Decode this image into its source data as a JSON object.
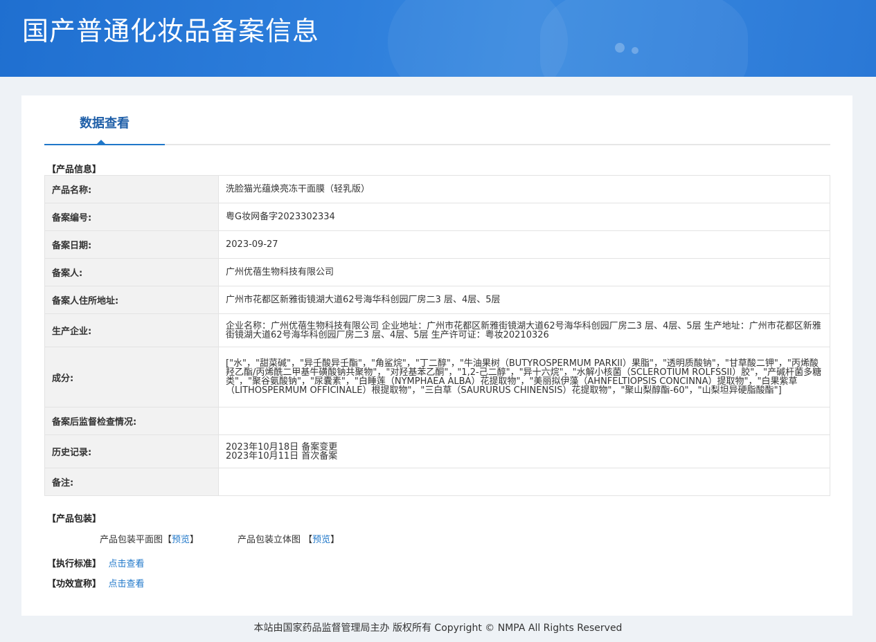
{
  "header": {
    "title": "国产普通化妆品备案信息"
  },
  "tabs": [
    {
      "label": "数据查看"
    }
  ],
  "product_info": {
    "section_label": "【产品信息】",
    "rows": [
      {
        "key": "产品名称:",
        "value": "洗脸猫光蕴焕亮冻干面膜（轻乳版）"
      },
      {
        "key": "备案编号:",
        "value": "粤G妆网备字2023302334"
      },
      {
        "key": "备案日期:",
        "value": "2023-09-27"
      },
      {
        "key": "备案人:",
        "value": "广州优蓓生物科技有限公司"
      },
      {
        "key": "备案人住所地址:",
        "value": "广州市花都区新雅街镜湖大道62号海华科创园厂房二3 层、4层、5层"
      },
      {
        "key": "生产企业:",
        "value": "企业名称：广州优蓓生物科技有限公司 企业地址：广州市花都区新雅街镜湖大道62号海华科创园厂房二3 层、4层、5层 生产地址：广州市花都区新雅街镜湖大道62号海华科创园厂房二3 层、4层、5层 生产许可证：粤妆20210326"
      },
      {
        "key": "成分:",
        "value": "[\"水\"，\"甜菜碱\"，\"异壬酸异壬酯\"，\"角鲨烷\"，\"丁二醇\"，\"牛油果树（BUTYROSPERMUM PARKII）果脂\"，\"透明质酸钠\"，\"甘草酸二钾\"，\"丙烯酸羟乙酯/丙烯酰二甲基牛磺酸钠共聚物\"，\"对羟基苯乙酮\"，\"1,2-己二醇\"，\"异十六烷\"，\"水解小核菌（SCLEROTIUM ROLFSSII）胶\"，\"产碱杆菌多糖类\"，\"聚谷氨酸钠\"，\"尿囊素\"，\"白睡莲（NYMPHAEA ALBA）花提取物\"，\"美丽拟伊藻（AHNFELTIOPSIS CONCINNA）提取物\"，\"白果紫草（LITHOSPERMUM OFFICINALE）根提取物\"，\"三白草（SAURURUS CHINENSIS）花提取物\"，\"聚山梨醇酯-60\"，\"山梨坦异硬脂酸酯\"]"
      },
      {
        "key": "备案后监督检查情况:",
        "value": ""
      },
      {
        "key": "历史记录:",
        "value": [
          "2023年10月18日 备案变更",
          "2023年10月11日 首次备案"
        ]
      },
      {
        "key": "备注:",
        "value": ""
      }
    ]
  },
  "packaging": {
    "section_label": "【产品包装】",
    "flat_label": "产品包装平面图【",
    "flat_link": "预览",
    "flat_close": "】",
    "solid_label": "产品包装立体图 【",
    "solid_link": "预览",
    "solid_close": "】"
  },
  "standard": {
    "label": "【执行标准】",
    "link": "点击查看"
  },
  "efficacy": {
    "label": "【功效宣称】",
    "link": "点击查看"
  },
  "footer": {
    "text": "本站由国家药品监督管理局主办 版权所有 Copyright © NMPA All Rights Reserved"
  }
}
